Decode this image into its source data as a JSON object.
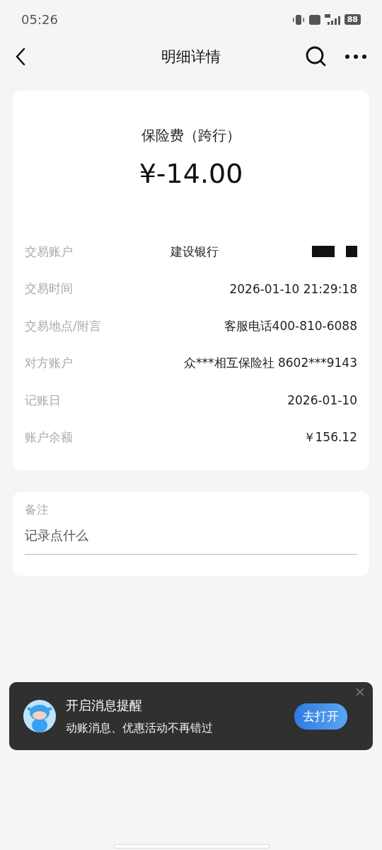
{
  "status_bar": {
    "time": "05:26",
    "battery": "88"
  },
  "nav": {
    "title": "明细详情"
  },
  "summary": {
    "title": "保险费（跨行）",
    "amount": "¥-14.00"
  },
  "details": [
    {
      "label": "交易账户",
      "value": "建设银行",
      "redacted": true
    },
    {
      "label": "交易时间",
      "value": "2026-01-10 21:29:18",
      "redacted": false
    },
    {
      "label": "交易地点/附言",
      "value": "客服电话400-810-6088",
      "redacted": false
    },
    {
      "label": "对方账户",
      "value": "众***相互保险社 8602***9143",
      "redacted": false
    },
    {
      "label": "记账日",
      "value": "2026-01-10",
      "redacted": false
    },
    {
      "label": "账户余额",
      "value": "￥156.12",
      "redacted": false
    }
  ],
  "note": {
    "label": "备注",
    "placeholder": "记录点什么"
  },
  "toast": {
    "title": "开启消息提醒",
    "subtitle": "动账消息、优惠活动不再错过",
    "button": "去打开"
  }
}
